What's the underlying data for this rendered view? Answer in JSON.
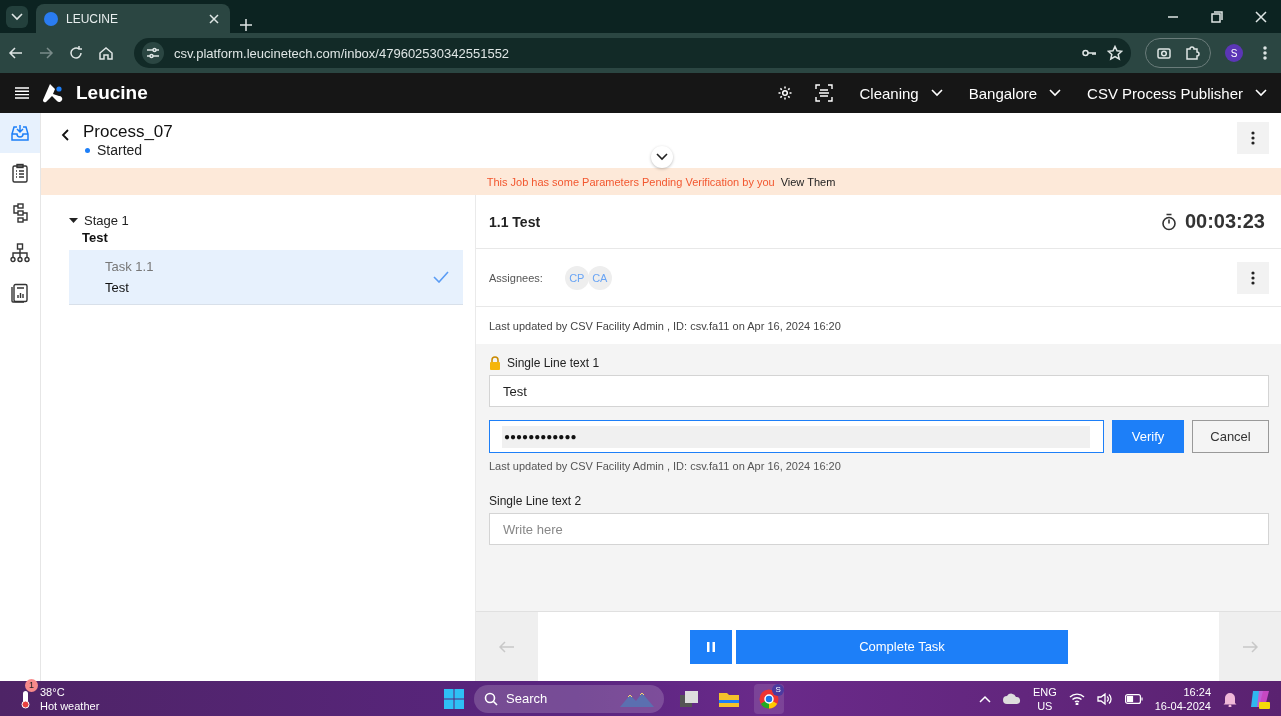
{
  "browser": {
    "tab_title": "LEUCINE",
    "url": "csv.platform.leucinetech.com/inbox/479602530342551552",
    "profile_initial": "S"
  },
  "header": {
    "brand": "Leucine",
    "dropdowns": [
      "Cleaning",
      "Bangalore",
      "CSV Process Publisher"
    ]
  },
  "nav_rail": [
    {
      "kind": "inbox",
      "selected": true
    },
    {
      "kind": "checklist",
      "selected": false
    },
    {
      "kind": "flow",
      "selected": false
    },
    {
      "kind": "hierarchy",
      "selected": false
    },
    {
      "kind": "report",
      "selected": false
    }
  ],
  "job": {
    "title": "Process_07",
    "status": "Started"
  },
  "banner": {
    "message": "This Job has some Parameters Pending Verification by you",
    "link": "View Them"
  },
  "stages": [
    {
      "label": "Stage 1",
      "name": "Test",
      "expanded": true,
      "tasks": [
        {
          "label": "Task 1.1",
          "name": "Test",
          "selected": true,
          "completed": true
        }
      ]
    }
  ],
  "task": {
    "title": "1.1 Test",
    "timer": "00:03:23",
    "assignees_label": "Assignees:",
    "assignees": [
      "CP",
      "CA"
    ],
    "last_updated": "Last updated by CSV Facility Admin , ID: csv.fa11 on Apr 16, 2024 16:20",
    "parameters": [
      {
        "label": "Single Line text 1",
        "locked": true,
        "value": "Test",
        "verification": {
          "value": "●●●●●●●●●●●●",
          "verify": "Verify",
          "cancel": "Cancel"
        },
        "last_updated": "Last updated by CSV Facility Admin , ID: csv.fa11 on Apr 16, 2024 16:20"
      },
      {
        "label": "Single Line text 2",
        "locked": false,
        "placeholder": "Write here"
      }
    ]
  },
  "footer": {
    "complete_label": "Complete Task"
  },
  "taskbar": {
    "temperature": "38°C",
    "weather": "Hot weather",
    "weather_badge": "1",
    "search_placeholder": "Search",
    "chrome_badge": "S",
    "language": "ENG",
    "region": "US",
    "time": "16:24",
    "date": "16-04-2024"
  }
}
